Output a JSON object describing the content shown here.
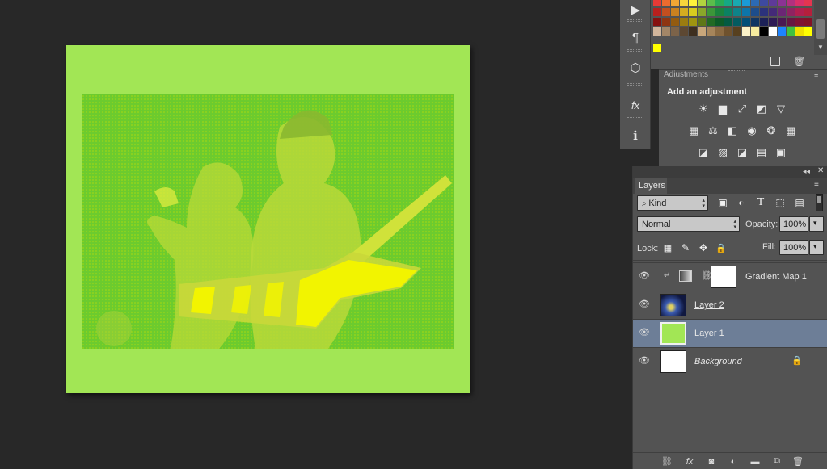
{
  "canvas": {
    "document_background": "#a2e655",
    "photo_background": "#6ccb2e",
    "photo_highlight": "#f2f400"
  },
  "tool_strip": {
    "items": [
      {
        "icon": "play-icon",
        "glyph": "▶"
      },
      {
        "icon": "paragraph-icon",
        "glyph": "¶"
      },
      {
        "icon": "3d-layers-icon",
        "glyph": "⬡"
      },
      {
        "icon": "fx-styles-icon",
        "glyph": "fx"
      },
      {
        "icon": "info-icon",
        "glyph": "ℹ"
      }
    ]
  },
  "swatches": {
    "rows": [
      [
        "#e83a36",
        "#ec6b2f",
        "#f3a634",
        "#f7d53c",
        "#fff33b",
        "#b2d33f",
        "#5bbd4b",
        "#29ab55",
        "#16a884",
        "#19aab0",
        "#1b9bd7",
        "#2c6ab3",
        "#3e4aa0",
        "#5e3a98",
        "#8b3394",
        "#b2307f",
        "#d9306a",
        "#e43550"
      ],
      [
        "#b8201e",
        "#c24f1f",
        "#c98120",
        "#d4ac20",
        "#d8cc1f",
        "#8aa62a",
        "#3c9639",
        "#1b823d",
        "#0c8162",
        "#0e8389",
        "#0d75a9",
        "#1d4d8b",
        "#2b327b",
        "#442a78",
        "#6b2675",
        "#8f2361",
        "#b01f4f",
        "#b51f3c"
      ],
      [
        "#85110f",
        "#8e3511",
        "#935b10",
        "#9b7c10",
        "#9f9510",
        "#5f7717",
        "#226a24",
        "#0d5b27",
        "#035a42",
        "#035b60",
        "#034f77",
        "#103562",
        "#1c2157",
        "#2e1b55",
        "#4b1853",
        "#661642",
        "#7f1133",
        "#831126"
      ],
      [
        "#d1b59b",
        "#a38667",
        "#7c6349",
        "#5d4832",
        "#3e2f1f",
        "#c9a77b",
        "#a6855b",
        "#8a6a42",
        "#6f522e",
        "#57401f",
        "#fbf1c7",
        "#f6eb9f",
        "#000000",
        "#ffffff",
        "#1e84ff",
        "#40c040",
        "#f0e000",
        "#ffff00"
      ]
    ]
  },
  "adjustments": {
    "tab_label": "Adjustments",
    "title": "Add an adjustment",
    "rows": [
      [
        {
          "icon": "brightness-icon",
          "glyph": "☀"
        },
        {
          "icon": "levels-icon",
          "glyph": "▆"
        },
        {
          "icon": "curves-icon",
          "glyph": "⤢"
        },
        {
          "icon": "exposure-icon",
          "glyph": "◩"
        },
        {
          "icon": "vibrance-icon",
          "glyph": "▽"
        }
      ],
      [
        {
          "icon": "hue-saturation-icon",
          "glyph": "▦"
        },
        {
          "icon": "color-balance-icon",
          "glyph": "⚖"
        },
        {
          "icon": "black-white-icon",
          "glyph": "◧"
        },
        {
          "icon": "photo-filter-icon",
          "glyph": "◉"
        },
        {
          "icon": "channel-mixer-icon",
          "glyph": "❂"
        },
        {
          "icon": "color-lookup-icon",
          "glyph": "▦"
        }
      ],
      [
        {
          "icon": "invert-icon",
          "glyph": "◪"
        },
        {
          "icon": "posterize-icon",
          "glyph": "▨"
        },
        {
          "icon": "threshold-icon",
          "glyph": "◪"
        },
        {
          "icon": "gradient-map-icon",
          "glyph": "▤"
        },
        {
          "icon": "selective-color-icon",
          "glyph": "▣"
        }
      ]
    ]
  },
  "layers": {
    "tab_label": "Layers",
    "filter_kind": "Kind",
    "blend_mode": "Normal",
    "opacity_label": "Opacity:",
    "opacity_value": "100%",
    "lock_label": "Lock:",
    "fill_label": "Fill:",
    "fill_value": "100%",
    "items": [
      {
        "name": "Gradient Map 1",
        "italic": false,
        "selected": false,
        "thumb_color": "#ffffff",
        "type": "adjustment"
      },
      {
        "name": "Layer 2",
        "italic": false,
        "selected": false,
        "thumb_color": "#101840",
        "type": "photo"
      },
      {
        "name": "Layer 1",
        "italic": false,
        "selected": true,
        "thumb_color": "#a2e655",
        "type": "fill"
      },
      {
        "name": "Background",
        "italic": true,
        "selected": false,
        "thumb_color": "#ffffff",
        "type": "background"
      }
    ],
    "selected_row_color": "#6d7e97"
  }
}
